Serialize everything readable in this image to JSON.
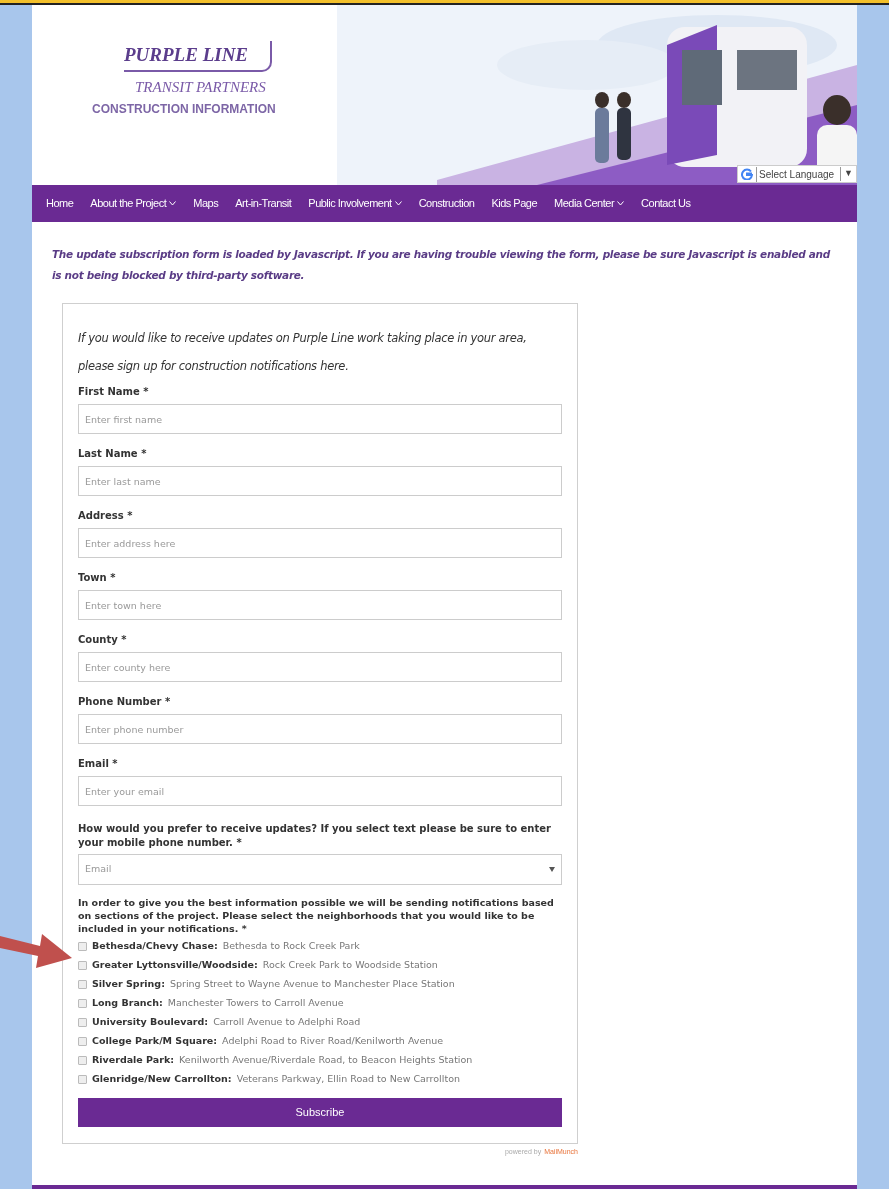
{
  "header": {
    "logo_title": "PURPLE LINE",
    "logo_subtitle": "TRANSIT PARTNERS",
    "tagline": "CONSTRUCTION INFORMATION",
    "language": {
      "label": "Select Language",
      "caret": "▼"
    }
  },
  "nav": [
    {
      "label": "Home",
      "has_menu": false
    },
    {
      "label": "About the Project",
      "has_menu": true
    },
    {
      "label": "Maps",
      "has_menu": false
    },
    {
      "label": "Art-in-Transit",
      "has_menu": false
    },
    {
      "label": "Public Involvement",
      "has_menu": true
    },
    {
      "label": "Construction",
      "has_menu": false
    },
    {
      "label": "Kids Page",
      "has_menu": false
    },
    {
      "label": "Media Center",
      "has_menu": true
    },
    {
      "label": "Contact Us",
      "has_menu": false
    }
  ],
  "notice": "The update subscription form is loaded by Javascript. If you are having trouble viewing the form, please be sure Javascript is enabled and is not being blocked by third-party software.",
  "form": {
    "intro": "If you would like to receive updates on Purple Line work taking place in your area, please sign up for construction notifications here.",
    "fields": [
      {
        "label": "First Name *",
        "placeholder": "Enter first name"
      },
      {
        "label": "Last Name *",
        "placeholder": "Enter last name"
      },
      {
        "label": "Address *",
        "placeholder": "Enter address here"
      },
      {
        "label": "Town *",
        "placeholder": "Enter town here"
      },
      {
        "label": "County *",
        "placeholder": "Enter county here"
      },
      {
        "label": "Phone Number *",
        "placeholder": "Enter phone number"
      },
      {
        "label": "Email *",
        "placeholder": "Enter your email"
      }
    ],
    "preference": {
      "label": "How would you prefer to receive updates? If you select text please be sure to enter your mobile phone number. *",
      "value": "Email"
    },
    "neighborhoods_label": "In order to give you the best information possible we will be sending notifications based on sections of the project. Please select the neighborhoods that you would like to be included in your notifications. *",
    "neighborhoods": [
      {
        "name": "Bethesda/Chevy Chase:",
        "description": "Bethesda to Rock Creek Park",
        "checked": false
      },
      {
        "name": "Greater Lyttonsville/Woodside:",
        "description": "Rock Creek Park to Woodside Station",
        "checked": false
      },
      {
        "name": "Silver Spring:",
        "description": "Spring Street to Wayne Avenue to Manchester Place Station",
        "checked": false
      },
      {
        "name": "Long Branch:",
        "description": "Manchester Towers to Carroll Avenue",
        "checked": false
      },
      {
        "name": "University Boulevard:",
        "description": "Carroll Avenue to Adelphi Road",
        "checked": false
      },
      {
        "name": "College Park/M Square:",
        "description": "Adelphi Road to River Road/Kenilworth Avenue",
        "checked": false
      },
      {
        "name": "Riverdale Park:",
        "description": "Kenilworth Avenue/Riverdale Road, to Beacon Heights Station",
        "checked": false
      },
      {
        "name": "Glenridge/New Carrollton:",
        "description": "Veterans Parkway, Ellin Road to New Carrollton",
        "checked": false
      }
    ],
    "submit": "Subscribe"
  },
  "powered_by": {
    "text": "powered by",
    "brand": "MailMunch"
  }
}
